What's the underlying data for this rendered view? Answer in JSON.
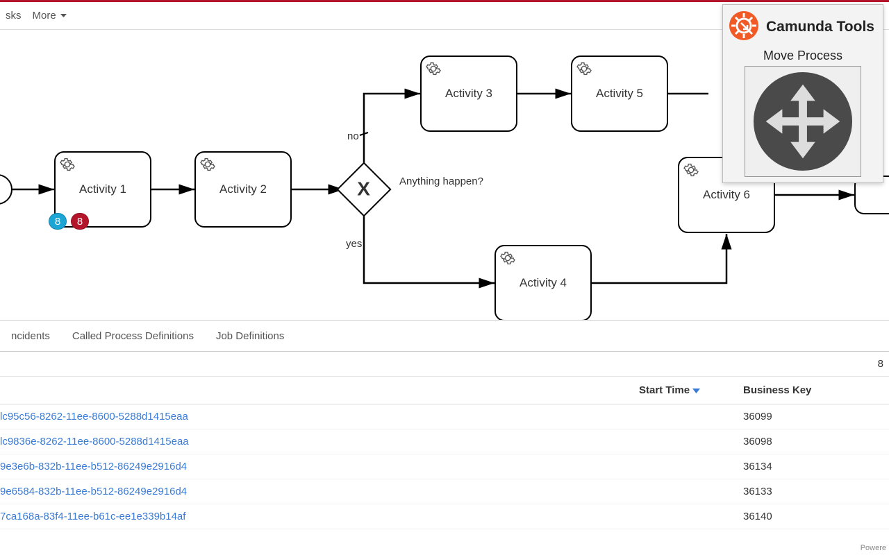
{
  "toolbar": {
    "items": [
      "sks",
      "More"
    ]
  },
  "diagram": {
    "start_event": true,
    "gateway_label": "Anything happen?",
    "gateway_no": "no",
    "gateway_yes": "yes",
    "activities": {
      "a1": "Activity 1",
      "a2": "Activity 2",
      "a3": "Activity 3",
      "a4": "Activity 4",
      "a5": "Activity 5",
      "a6": "Activity 6"
    },
    "badges": {
      "blue": "8",
      "red": "8"
    }
  },
  "tabs": [
    "ncidents",
    "Called Process Definitions",
    "Job Definitions"
  ],
  "instance_count": "8",
  "table": {
    "headers": {
      "start": "Start Time",
      "bkey": "Business Key"
    },
    "rows": [
      {
        "id": "lc95c56-8262-11ee-8600-5288d1415eaa",
        "bkey": "36099"
      },
      {
        "id": "lc9836e-8262-11ee-8600-5288d1415eaa",
        "bkey": "36098"
      },
      {
        "id": "9e3e6b-832b-11ee-b512-86249e2916d4",
        "bkey": "36134"
      },
      {
        "id": "9e6584-832b-11ee-b512-86249e2916d4",
        "bkey": "36133"
      },
      {
        "id": "7ca168a-83f4-11ee-b61c-ee1e339b14af",
        "bkey": "36140"
      }
    ]
  },
  "tools_panel": {
    "title": "Camunda Tools",
    "subtitle": "Move Process"
  },
  "footer": "Powere"
}
